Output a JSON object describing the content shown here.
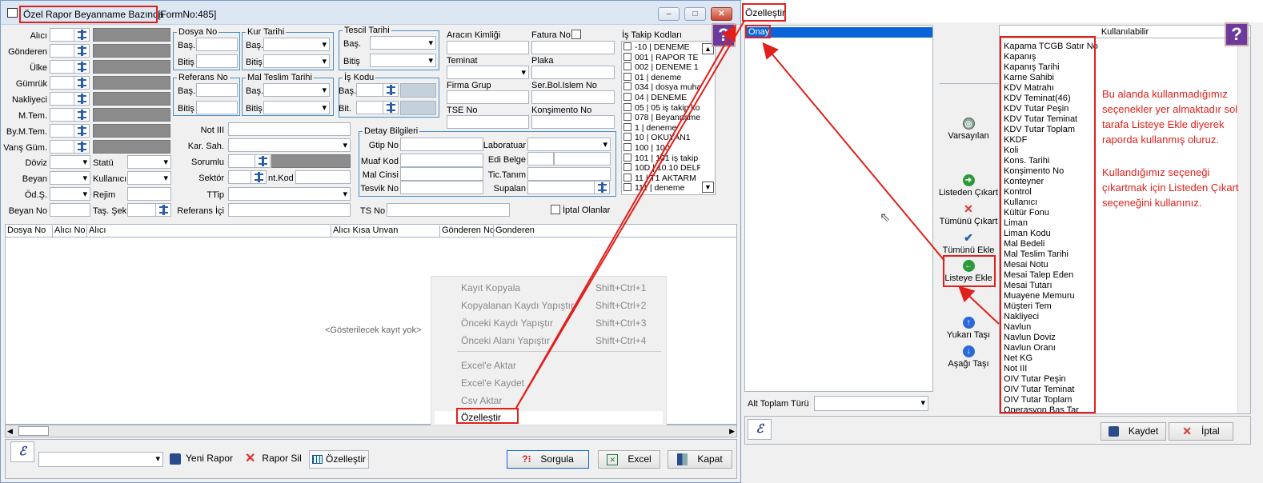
{
  "left_window": {
    "title": "Özel Rapor Beyanname Bazında",
    "form_no": "[FormNo:485]",
    "controls": {
      "minimize": "‒",
      "maximize": "□",
      "close": "✕"
    },
    "fields": {
      "alici": "Alıcı",
      "gonderen": "Gönderen",
      "ulke": "Ülke",
      "gumruk": "Gümrük",
      "nakliyeci": "Nakliyeci",
      "m_tem": "M.Tem.",
      "by_m_tem": "By.M.Tem.",
      "varis_gum": "Varış Güm.",
      "doviz": "Döviz",
      "beyan": "Beyan",
      "od_s": "Öd.Ş.",
      "beyan_no": "Beyan No",
      "statu": "Statü",
      "kullanici": "Kullanıcı",
      "rejim": "Rejim",
      "tas_sek": "Taş. Şek",
      "not_iii": "Not III",
      "kar_sah": "Kar. Sah.",
      "sorumlu": "Sorumlu",
      "sektor": "Sektör",
      "int_kod": "nt.Kod",
      "ttip": "TTip",
      "referans_ici": "Referans İçi",
      "aracin_kimligi": "Aracın Kimliği",
      "fatura_no": "Fatura No",
      "teminat": "Teminat",
      "plaka": "Plaka",
      "firma_grup": "Firma Grup",
      "ser_bol": "Ser.Bol.Islem No",
      "tse_no": "TSE No",
      "konsimento_no": "Konşimento No",
      "ts_no": "TS No",
      "iptal_olanlar": "İptal Olanlar",
      "is_takip_kodlari": "İş Takip Kodları"
    },
    "groups": {
      "dosya_no": "Dosya No",
      "kur_tarihi": "Kur Tarihi",
      "tescil_tarihi": "Tescil Tarihi",
      "referans_no": "Referans No",
      "mal_teslim_tarihi": "Mal Teslim Tarihi",
      "is_kodu": "İş Kodu",
      "bas": "Baş.",
      "bitis": "Bitiş",
      "bit": "Bit.",
      "detay": "Detay Bilgileri",
      "gtip_no": "Gtip No",
      "muaf_kod": "Muaf Kod",
      "mal_cinsi": "Mal Cinsi",
      "tesvik_no": "Tesvik No",
      "laboratuar": "Laboratuar",
      "edi_belge": "Edi Belge",
      "tic_tanim": "Tic.Tanım",
      "supalan": "Supalan"
    },
    "is_takip_list": [
      "-10 | DENEME",
      "001 | RAPOR TE",
      "002 | DENEME 1",
      "01 | deneme",
      "034 | dosya muha",
      "04 | DENEME",
      "05 | 05 iş takip ko",
      "078 | Beyanname",
      "1 | deneme",
      "10 | OKUYAN1",
      "100 | 100",
      "101 | 101 iş takip",
      "10D | 10.10 DELF",
      "11 | T1 AKTARM",
      "111 | deneme"
    ],
    "grid": {
      "columns": [
        "Dosya No",
        "Alıcı No",
        "Alıcı",
        "Alıcı Kısa Unvan",
        "Gönderen No",
        "Gonderen"
      ],
      "empty": "<Gösterilecek kayıt yok>"
    },
    "context_menu": [
      {
        "label": "Kayıt Kopyala",
        "shortcut": "Shift+Ctrl+1"
      },
      {
        "label": "Kopyalanan Kaydı Yapıştır",
        "shortcut": "Shift+Ctrl+2"
      },
      {
        "label": "Önceki Kaydı Yapıştır",
        "shortcut": "Shift+Ctrl+3"
      },
      {
        "label": "Önceki Alanı Yapıştır",
        "shortcut": "Shift+Ctrl+4"
      },
      {
        "label": "Excel'e Aktar",
        "shortcut": ""
      },
      {
        "label": "Excel'e Kaydet",
        "shortcut": ""
      },
      {
        "label": "Csv Aktar",
        "shortcut": ""
      },
      {
        "label": "Özelleştir",
        "shortcut": ""
      }
    ],
    "toolbar": {
      "yeni_rapor": "Yeni Rapor",
      "rapor_sil": "Rapor Sil",
      "ozellestir": "Özelleştir",
      "sorgula": "Sorgula",
      "excel": "Excel",
      "kapat": "Kapat"
    }
  },
  "right_window": {
    "title": "Özelleştir",
    "used_header": "",
    "used_items": [
      "Onay"
    ],
    "available_header": "Kullanılabilir",
    "alt_toplam": "Alt Toplam Türü",
    "side_buttons": {
      "varsayilan": "Varsayılan",
      "listeden_cikart": "Listeden Çıkart",
      "tumunu_cikart": "Tümünü Çıkart",
      "tumunu_ekle": "Tümünü Ekle",
      "listeye_ekle": "Listeye Ekle",
      "yukari_tasi": "Yukarı Taşı",
      "asagi_tasi": "Aşağı Taşı"
    },
    "available_items": [
      "Kapama TCGB Satır No",
      "Kapanış",
      "Kapanış Tarihi",
      "Karne Sahibi",
      "KDV Matrahı",
      "KDV Teminat(46)",
      "KDV Tutar Peşin",
      "KDV Tutar Teminat",
      "KDV Tutar Toplam",
      "KKDF",
      "Koli",
      "Kons. Tarihi",
      "Konşimento No",
      "Konteyner",
      "Kontrol",
      "Kullanıcı",
      "Kültür Fonu",
      "Liman",
      "Liman Kodu",
      "Mal Bedeli",
      "Mal Teslim Tarihi",
      "Mesai Notu",
      "Mesai Talep Eden",
      "Mesai Tutarı",
      "Muayene Memuru",
      "Müşteri Tem",
      "Nakliyeci",
      "Navlun",
      "Navlun Doviz",
      "Navlun Oranı",
      "Net KG",
      "Not III",
      "OIV Tutar Peşin",
      "OIV Tutar Teminat",
      "OIV Tutar Toplam",
      "Operasyon Baş Tar"
    ],
    "annotation_1": "Bu alanda kullanmadığımız seçenekler yer almaktadır sol tarafa Listeye Ekle diyerek raporda kullanmış oluruz.",
    "annotation_2": "Kullandığımız seçeneği çıkartmak için Listeden Çıkart seçeneğini kullanınız.",
    "buttons": {
      "kaydet": "Kaydet",
      "iptal": "İptal"
    }
  },
  "colors": {
    "annotation": "#e0201c",
    "selection": "#0a64d8",
    "accent": "#4a8ec4"
  }
}
